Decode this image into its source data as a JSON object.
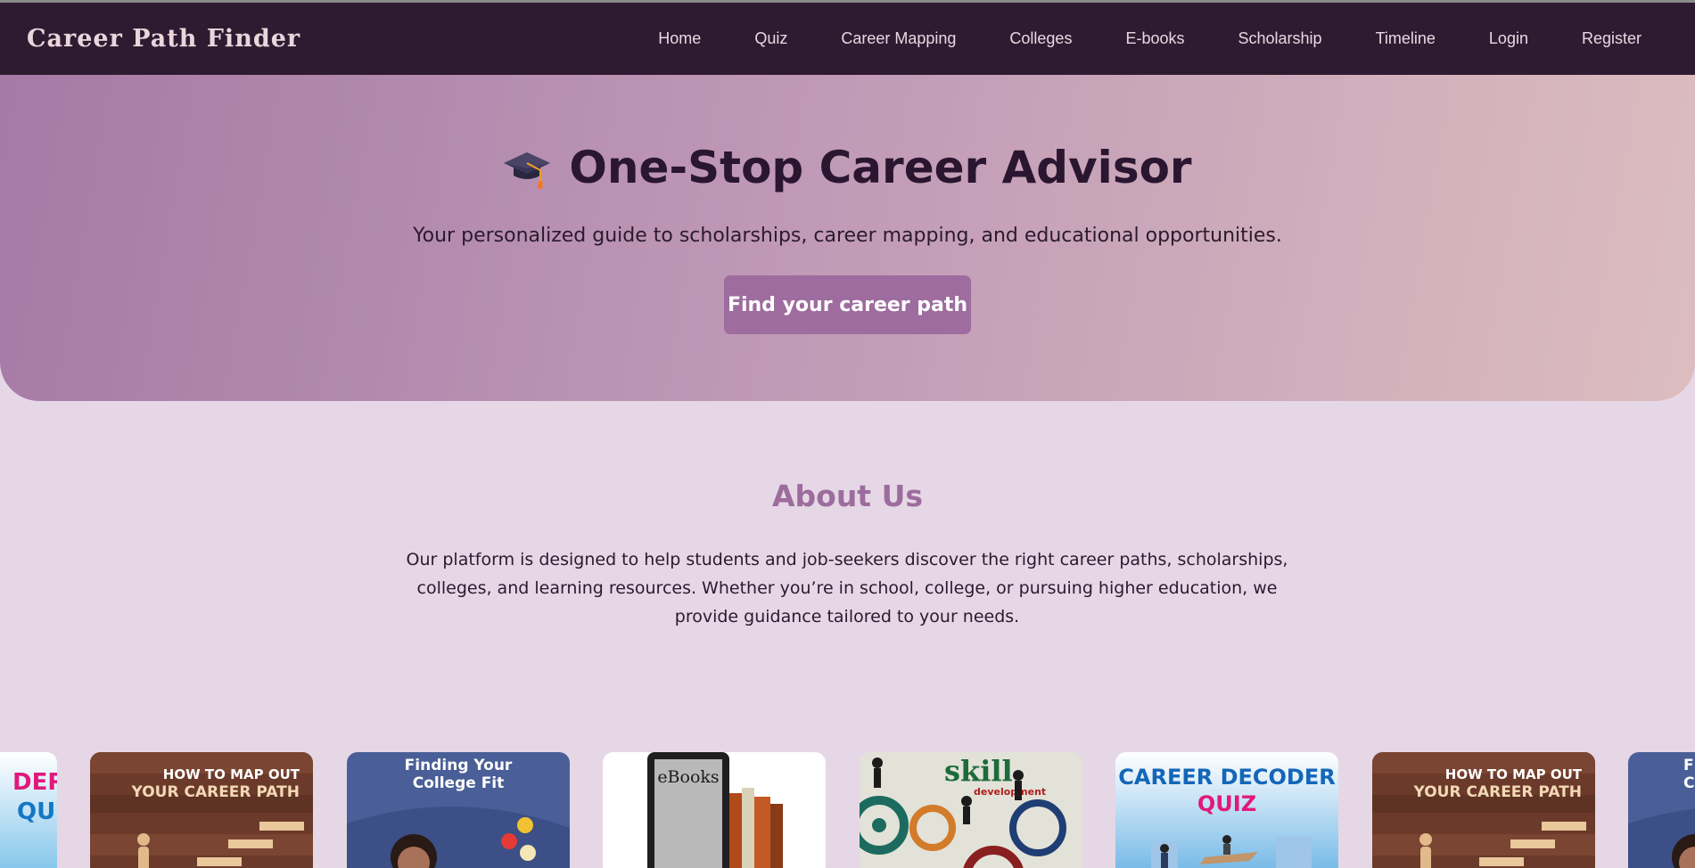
{
  "brand": "Career Path Finder",
  "nav": {
    "items": [
      "Home",
      "Quiz",
      "Career Mapping",
      "Colleges",
      "E-books",
      "Scholarship",
      "Timeline",
      "Login",
      "Register"
    ]
  },
  "hero": {
    "icon": "graduation-cap-icon",
    "title": "One-Stop Career Advisor",
    "subtitle": "Your personalized guide to scholarships, career mapping, and educational opportunities.",
    "cta_label": "Find your career path"
  },
  "about": {
    "title": "About Us",
    "text": "Our platform is designed to help students and job-seekers discover the right career paths, scholarships, colleges, and learning resources. Whether you’re in school, college, or pursuing higher education, we provide guidance tailored to your needs."
  },
  "carousel": {
    "cards": [
      {
        "kind": "quiz",
        "lines": [
          "DER",
          "QUIZ"
        ]
      },
      {
        "kind": "map",
        "lines": [
          "HOW TO MAP OUT",
          "YOUR CAREER PATH"
        ]
      },
      {
        "kind": "college",
        "lines": [
          "Finding Your",
          "College Fit"
        ]
      },
      {
        "kind": "ebook",
        "lines": [
          "eBooks"
        ]
      },
      {
        "kind": "skill",
        "lines": [
          "skill",
          "development"
        ]
      },
      {
        "kind": "quiz",
        "lines": [
          "CAREER DECODER",
          "QUIZ"
        ]
      },
      {
        "kind": "map",
        "lines": [
          "HOW TO MAP OUT",
          "YOUR CAREER PATH"
        ]
      },
      {
        "kind": "college",
        "lines": [
          "F",
          "C"
        ]
      }
    ]
  },
  "colors": {
    "navbar": "#2e1b31",
    "accent": "#9e6c9e",
    "page_bg": "#e6d7e7",
    "hero_gradient_start": "#a57aa5",
    "hero_gradient_end": "#dcbdbf"
  }
}
